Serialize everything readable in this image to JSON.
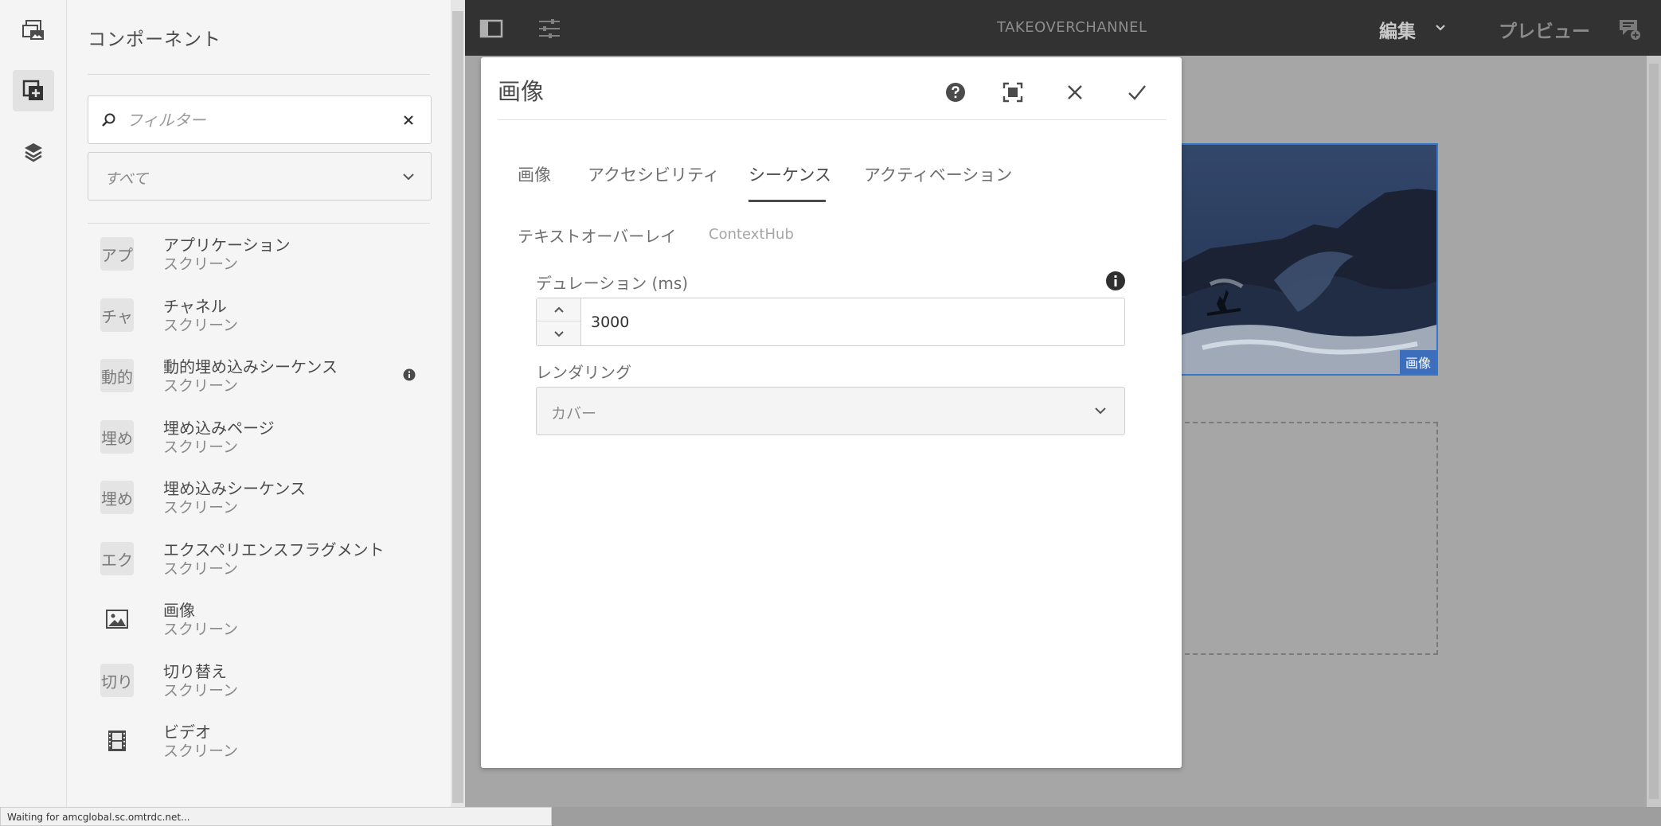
{
  "rail": {
    "items": [
      {
        "name": "assets-icon"
      },
      {
        "name": "components-icon"
      },
      {
        "name": "content-tree-icon"
      }
    ]
  },
  "panel": {
    "title": "コンポーネント",
    "filter": {
      "placeholder": "フィルター"
    },
    "group_select": {
      "value": "すべて"
    },
    "components": [
      {
        "badge": "アプ",
        "name": "アプリケーション",
        "group": "スクリーン"
      },
      {
        "badge": "チャ",
        "name": "チャネル",
        "group": "スクリーン"
      },
      {
        "badge": "動的",
        "name": "動的埋め込みシーケンス",
        "group": "スクリーン"
      },
      {
        "badge": "埋め",
        "name": "埋め込みページ",
        "group": "スクリーン"
      },
      {
        "badge": "埋め",
        "name": "埋め込みシーケンス",
        "group": "スクリーン"
      },
      {
        "badge": "エク",
        "name": "エクスペリエンスフラグメント",
        "group": "スクリーン"
      },
      {
        "badge": "",
        "icon": "image-icon",
        "name": "画像",
        "group": "スクリーン"
      },
      {
        "badge": "切り",
        "name": "切り替え",
        "group": "スクリーン"
      },
      {
        "badge": "",
        "icon": "film-icon",
        "name": "ビデオ",
        "group": "スクリーン"
      }
    ]
  },
  "status_bar": "Waiting for amcglobal.sc.omtrdc.net...",
  "topbar": {
    "title": "TAKEOVERCHANNEL",
    "mode": "編集",
    "preview": "プレビュー"
  },
  "canvas": {
    "image_label": "画像"
  },
  "dialog": {
    "title": "画像",
    "tabs": [
      "画像",
      "アクセシビリティ",
      "シーケンス",
      "アクティベーション"
    ],
    "selected_tab": "シーケンス",
    "subtabs": [
      "テキストオーバーレイ",
      "ContextHub"
    ],
    "duration": {
      "label": "デュレーション (ms)",
      "value": "3000"
    },
    "rendering": {
      "label": "レンダリング",
      "value": "カバー"
    }
  },
  "colors": {
    "topbar": "#323232",
    "panel": "#f5f5f5",
    "canvas": "#a6a6a6",
    "selection": "#3377cc"
  }
}
